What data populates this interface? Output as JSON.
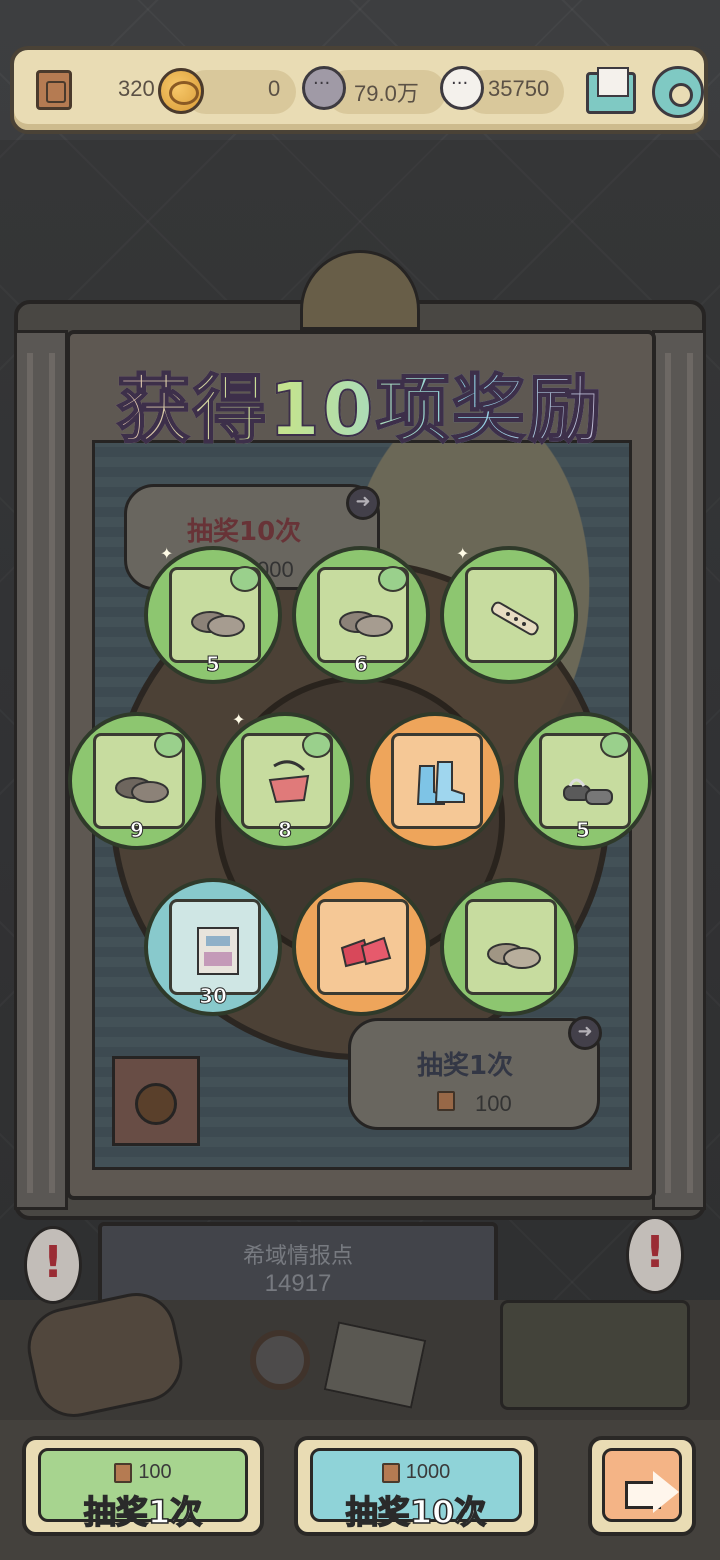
{
  "topbar": {
    "tickets": "320",
    "coins": "0",
    "dark_bubbles": "79.0万",
    "light_bubbles": "35750"
  },
  "title": "获得10项奖励",
  "background_panels": {
    "draw10_label": "抽奖10次",
    "draw10_cost_partial": "000",
    "draw1_label": "抽奖1次",
    "draw1_cost": "100"
  },
  "info_point": {
    "label": "希域情报点",
    "value": "14917"
  },
  "rewards": [
    {
      "icon": "stone-clogs-icon",
      "count": "5",
      "rarity": "green"
    },
    {
      "icon": "stone-clogs-icon",
      "count": "6",
      "rarity": "green"
    },
    {
      "icon": "flute-icon",
      "count": "",
      "rarity": "green"
    },
    {
      "icon": "stone-clogs-icon",
      "count": "9",
      "rarity": "green"
    },
    {
      "icon": "red-bag-icon",
      "count": "8",
      "rarity": "green"
    },
    {
      "icon": "blue-boots-icon",
      "count": "",
      "rarity": "orange"
    },
    {
      "icon": "platform-sandals-icon",
      "count": "5",
      "rarity": "green"
    },
    {
      "icon": "map-scroll-icon",
      "count": "30",
      "rarity": "blue"
    },
    {
      "icon": "red-heels-icon",
      "count": "",
      "rarity": "orange"
    },
    {
      "icon": "stone-clogs-icon",
      "count": "",
      "rarity": "green"
    }
  ],
  "buttons": {
    "draw1": {
      "cost": "100",
      "label": "抽奖1次"
    },
    "draw10": {
      "cost": "1000",
      "label": "抽奖10次"
    }
  },
  "colors": {
    "green_rarity": "#8dc670",
    "orange_rarity": "#eea55b",
    "blue_rarity": "#88c9cc"
  }
}
